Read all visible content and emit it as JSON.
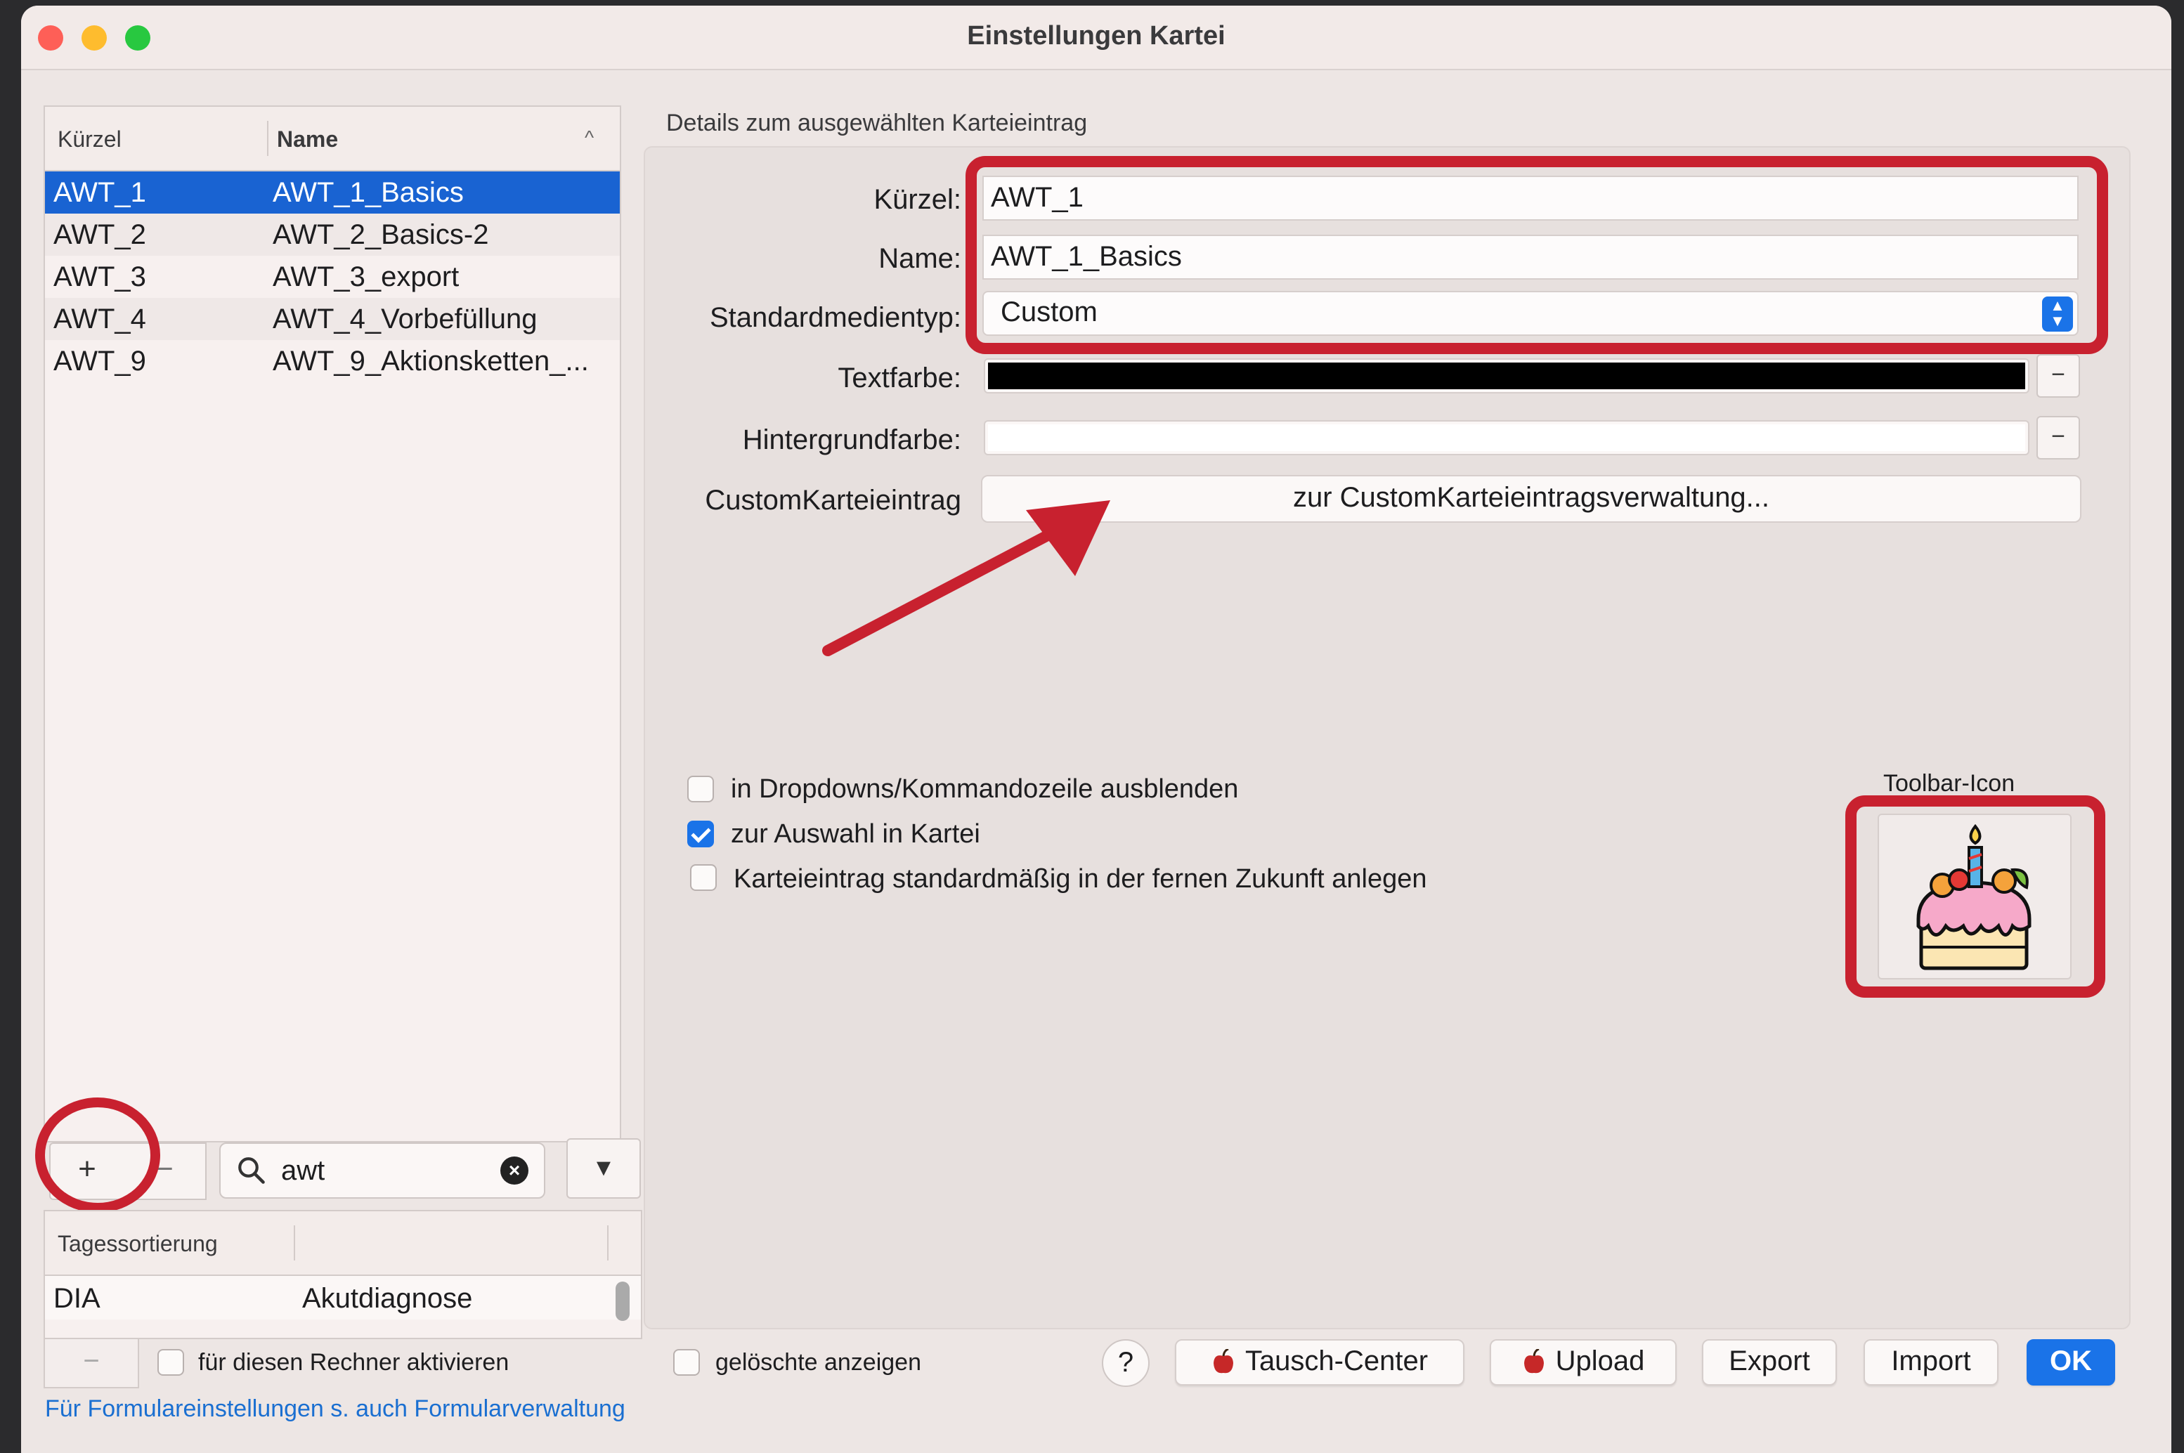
{
  "window": {
    "title": "Einstellungen Kartei"
  },
  "list": {
    "col_kurzel": "Kürzel",
    "col_name": "Name",
    "sort_indicator": "^",
    "rows": [
      {
        "kurzel": "AWT_1",
        "name": "AWT_1_Basics",
        "selected": true
      },
      {
        "kurzel": "AWT_2",
        "name": "AWT_2_Basics-2"
      },
      {
        "kurzel": "AWT_3",
        "name": "AWT_3_export"
      },
      {
        "kurzel": "AWT_4",
        "name": "AWT_4_Vorbefüllung"
      },
      {
        "kurzel": "AWT_9",
        "name": "AWT_9_Aktionsketten_..."
      }
    ],
    "add_label": "+",
    "remove_label": "−",
    "search_value": "awt",
    "dropdown_label": "▼"
  },
  "tages": {
    "header": "Tagessortierung",
    "rows": [
      {
        "code": "DIA",
        "name": "Akutdiagnose"
      }
    ],
    "minus_label": "−",
    "activate_label": "für diesen Rechner aktivieren"
  },
  "footer": {
    "link": "Für Formulareinstellungen s. auch Formularverwaltung",
    "show_deleted": "gelöschte anzeigen",
    "help": "?",
    "tausch": "Tausch-Center",
    "upload": "Upload",
    "export": "Export",
    "import": "Import",
    "ok": "OK"
  },
  "details": {
    "caption": "Details zum ausgewählten Karteieintrag",
    "kurzel_label": "Kürzel:",
    "kurzel_value": "AWT_1",
    "name_label": "Name:",
    "name_value": "AWT_1_Basics",
    "medien_label": "Standardmedientyp:",
    "medien_value": "Custom",
    "textfarbe_label": "Textfarbe:",
    "hintergrund_label": "Hintergrundfarbe:",
    "custom_label": "CustomKarteieintrag",
    "custom_button": "zur CustomKarteieintragsverwaltung...",
    "minus": "−",
    "checkbox1": "in Dropdowns/Kommandozeile ausblenden",
    "checkbox2": "zur Auswahl in Kartei",
    "checkbox3": "Karteieintrag standardmäßig in der fernen Zukunft anlegen",
    "toolbar_icon_label": "Toolbar-Icon",
    "text_color": "#000000",
    "background_color": "#ffffff"
  },
  "colors": {
    "accent": "#1a73e8",
    "annotation": "#c8212f",
    "selection": "#1963d2"
  }
}
